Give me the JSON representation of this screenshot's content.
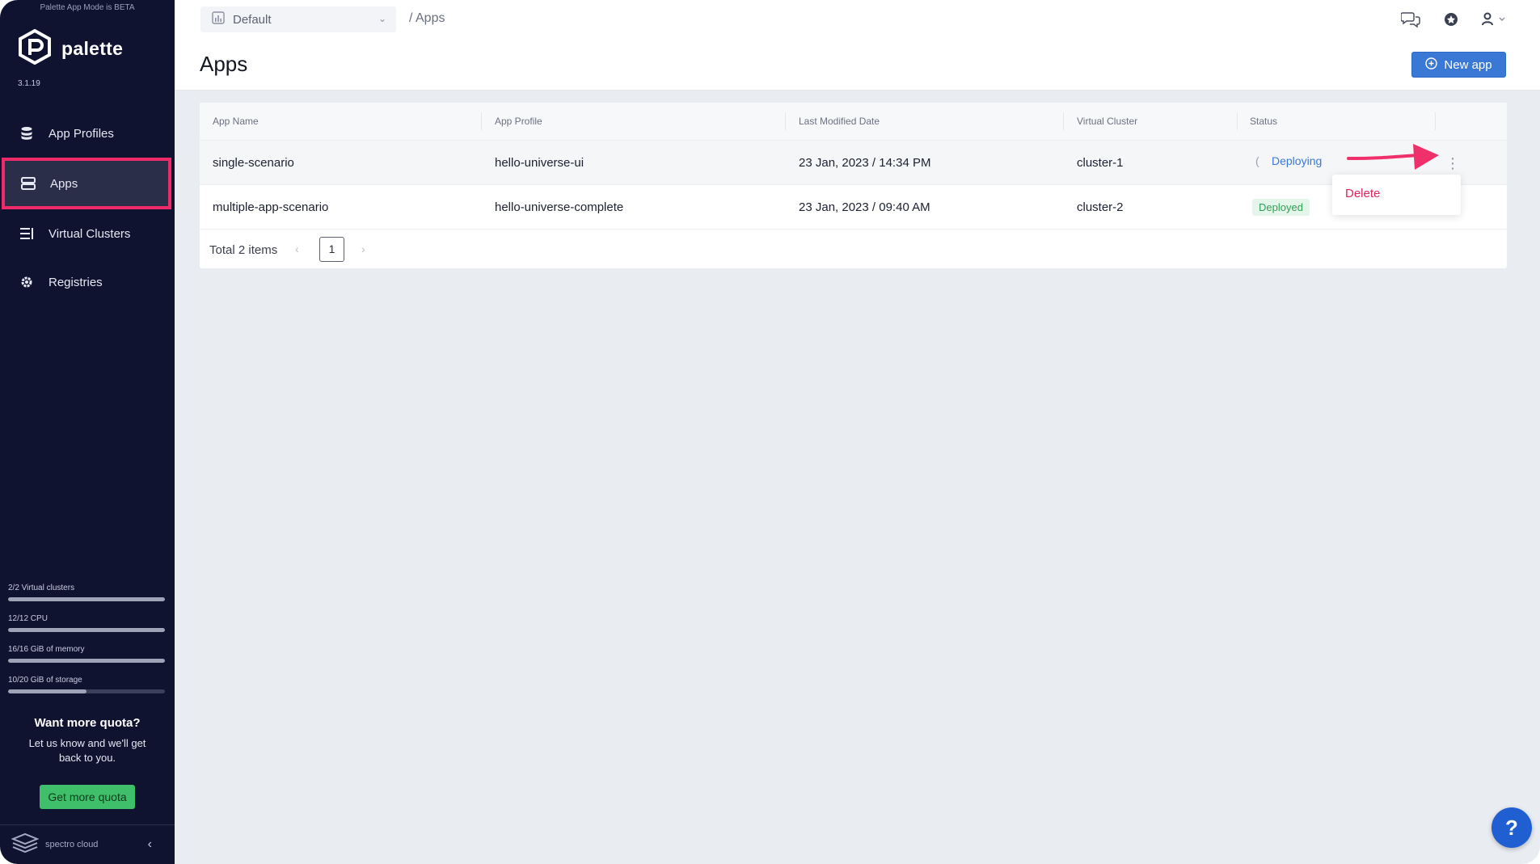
{
  "sidebar": {
    "beta_note": "Palette App Mode is BETA",
    "brand": "palette",
    "version": "3.1.19",
    "items": [
      {
        "label": "App Profiles",
        "icon": "database-icon"
      },
      {
        "label": "Apps",
        "icon": "apps-icon",
        "active": true
      },
      {
        "label": "Virtual Clusters",
        "icon": "clusters-icon"
      },
      {
        "label": "Registries",
        "icon": "gear-icon"
      }
    ],
    "quota": [
      {
        "label": "2/2 Virtual clusters",
        "fraction": 1.0
      },
      {
        "label": "12/12 CPU",
        "fraction": 1.0
      },
      {
        "label": "16/16 GiB of memory",
        "fraction": 1.0
      },
      {
        "label": "10/20 GiB of storage",
        "fraction": 0.5
      }
    ],
    "more_quota_title": "Want more quota?",
    "more_quota_text": "Let us know and we'll get back to you.",
    "more_quota_button": "Get more quota",
    "footer_brand": "spectro cloud"
  },
  "header": {
    "scope": "Default",
    "breadcrumb": "/ Apps",
    "title": "Apps",
    "new_app_label": "New app"
  },
  "table": {
    "columns": [
      "App Name",
      "App Profile",
      "Last Modified Date",
      "Virtual Cluster",
      "Status"
    ],
    "rows": [
      {
        "name": "single-scenario",
        "profile": "hello-universe-ui",
        "modified": "23 Jan, 2023 / 14:34 PM",
        "cluster": "cluster-1",
        "status": "Deploying"
      },
      {
        "name": "multiple-app-scenario",
        "profile": "hello-universe-complete",
        "modified": "23 Jan, 2023 / 09:40 AM",
        "cluster": "cluster-2",
        "status": "Deployed"
      }
    ],
    "total": "Total 2 items",
    "page": "1"
  },
  "row_menu": {
    "delete": "Delete"
  },
  "help": "?",
  "colors": {
    "sidebar_bg": "#0f1330",
    "accent": "#3a78d6",
    "highlight": "#ee2a68",
    "success": "#3fbf6a"
  }
}
